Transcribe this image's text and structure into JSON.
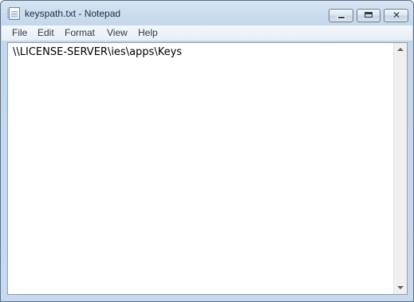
{
  "window": {
    "title": "keyspath.txt - Notepad",
    "icon": "notepad-icon",
    "controls": {
      "minimize": "minimize-icon",
      "maximize": "restore-icon",
      "close": "close-icon",
      "close_glyph": "✕"
    }
  },
  "menu": {
    "items": [
      "File",
      "Edit",
      "Format",
      "View",
      "Help"
    ]
  },
  "editor": {
    "content": "\\\\LICENSE-SERVER\\ies\\apps\\Keys"
  },
  "colors": {
    "frame": "#c4d7ec",
    "border": "#5a6f87",
    "menubar": "#eef3f9"
  }
}
